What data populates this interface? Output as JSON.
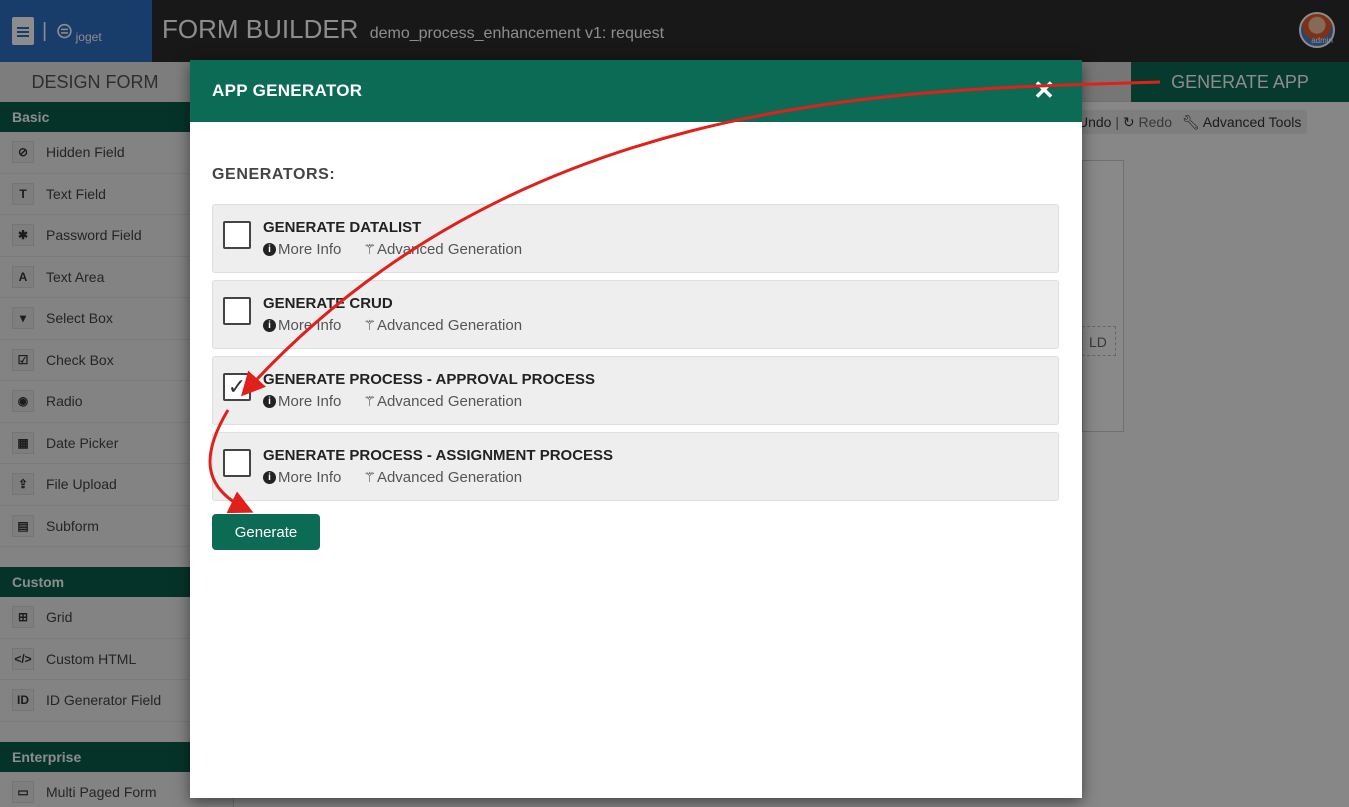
{
  "header": {
    "logo_text": "joget",
    "logo_sep": "|",
    "title": "FORM BUILDER",
    "subtitle": "demo_process_enhancement v1: request",
    "avatar_label": "admin"
  },
  "tabs": {
    "design": "DESIGN FORM",
    "generate": "GENERATE APP"
  },
  "sidebar": {
    "basic_label": "Basic",
    "basic_items": [
      {
        "label": "Hidden Field",
        "icon": "eye-slash-icon",
        "glyph": "⊘"
      },
      {
        "label": "Text Field",
        "icon": "text-field-icon",
        "glyph": "T"
      },
      {
        "label": "Password Field",
        "icon": "asterisk-icon",
        "glyph": "✱"
      },
      {
        "label": "Text Area",
        "icon": "text-area-icon",
        "glyph": "A"
      },
      {
        "label": "Select Box",
        "icon": "select-box-icon",
        "glyph": "▾"
      },
      {
        "label": "Check Box",
        "icon": "check-box-icon",
        "glyph": "☑"
      },
      {
        "label": "Radio",
        "icon": "radio-icon",
        "glyph": "◉"
      },
      {
        "label": "Date Picker",
        "icon": "calendar-icon",
        "glyph": "▦"
      },
      {
        "label": "File Upload",
        "icon": "upload-icon",
        "glyph": "⇪"
      },
      {
        "label": "Subform",
        "icon": "subform-icon",
        "glyph": "▤"
      }
    ],
    "custom_label": "Custom",
    "custom_items": [
      {
        "label": "Grid",
        "icon": "grid-icon",
        "glyph": "⊞"
      },
      {
        "label": "Custom HTML",
        "icon": "code-icon",
        "glyph": "</>"
      },
      {
        "label": "ID Generator Field",
        "icon": "id-icon",
        "glyph": "ID"
      }
    ],
    "enterprise_label": "Enterprise",
    "enterprise_items": [
      {
        "label": "Multi Paged Form",
        "icon": "multi-page-icon",
        "glyph": "▭"
      }
    ]
  },
  "toolbar": {
    "undo": "Undo",
    "sep": "|",
    "redo": "Redo",
    "advanced_tools": "Advanced Tools"
  },
  "canvas": {
    "fragment": "LD"
  },
  "modal": {
    "title": "APP GENERATOR",
    "close_glyph": "✕",
    "section_label": "GENERATORS:",
    "more_info": "More Info",
    "advanced": "Advanced Generation",
    "generators": [
      {
        "name": "GENERATE DATALIST",
        "checked": false
      },
      {
        "name": "GENERATE CRUD",
        "checked": false
      },
      {
        "name": "GENERATE PROCESS - APPROVAL PROCESS",
        "checked": true
      },
      {
        "name": "GENERATE PROCESS - ASSIGNMENT PROCESS",
        "checked": false
      }
    ],
    "generate_button": "Generate"
  },
  "annotation_color": "#e0201a",
  "accent_color": "#0c6b55"
}
